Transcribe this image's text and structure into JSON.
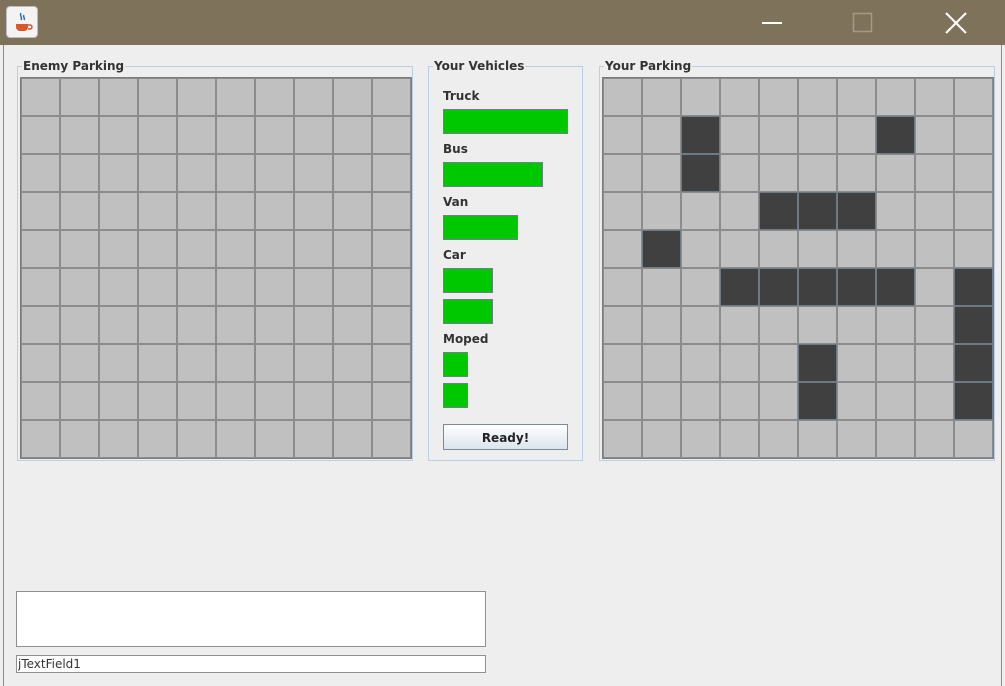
{
  "window": {
    "title": "",
    "titlebar_color": "#7f725a",
    "controls": [
      "minimize-icon",
      "maximize-icon",
      "close-icon"
    ]
  },
  "enemy_parking": {
    "title": "Enemy Parking",
    "rows": 10,
    "cols": 10,
    "occupied": []
  },
  "vehicles": {
    "title": "Your Vehicles",
    "items": [
      {
        "label": "Truck",
        "bars": [
          5
        ]
      },
      {
        "label": "Bus",
        "bars": [
          4
        ]
      },
      {
        "label": "Van",
        "bars": [
          3
        ]
      },
      {
        "label": "Car",
        "bars": [
          2,
          2
        ]
      },
      {
        "label": "Moped",
        "bars": [
          1,
          1
        ]
      }
    ],
    "ready_label": "Ready!",
    "bar_color": "#00c800"
  },
  "your_parking": {
    "title": "Your Parking",
    "rows": 10,
    "cols": 10,
    "occupied": [
      [
        1,
        2
      ],
      [
        2,
        2
      ],
      [
        1,
        7
      ],
      [
        3,
        4
      ],
      [
        3,
        5
      ],
      [
        3,
        6
      ],
      [
        4,
        1
      ],
      [
        5,
        3
      ],
      [
        5,
        4
      ],
      [
        5,
        5
      ],
      [
        5,
        6
      ],
      [
        5,
        7
      ],
      [
        5,
        9
      ],
      [
        6,
        9
      ],
      [
        7,
        9
      ],
      [
        8,
        9
      ],
      [
        7,
        5
      ],
      [
        8,
        5
      ]
    ]
  },
  "log_area": {
    "value": ""
  },
  "text_field": {
    "value": "jTextField1"
  }
}
